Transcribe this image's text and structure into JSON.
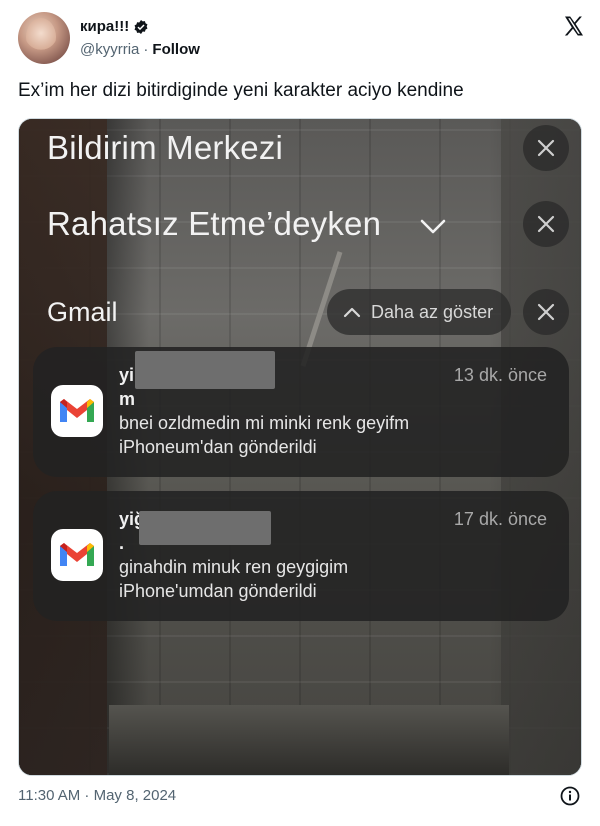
{
  "tweet": {
    "display_name": "кира!!!",
    "handle": "@kyyrria",
    "separator": "·",
    "follow_label": "Follow",
    "text": "Ex’im her dizi bitirdiginde yeni karakter aciyo kendine",
    "timestamp": "11:30 AM · May 8, 2024"
  },
  "screenshot": {
    "title": "Bildirim Merkezi",
    "dnd_label": "Rahatsız Etme’deyken",
    "app_group": "Gmail",
    "show_less_label": "Daha az göster",
    "notifications": [
      {
        "sender": "yi",
        "time": "13 dk. önce",
        "subject": "m",
        "line1": "bnei ozldmedin mi minki renk geyifm",
        "line2": "iPhoneum'dan gönderildi"
      },
      {
        "sender": "yiğ",
        "time": "17 dk. önce",
        "subject": ".",
        "line1": "ginahdin minuk ren geygigim",
        "line2": "iPhone'umdan gönderildi"
      }
    ]
  },
  "icons": {
    "verified": "verified-badge-icon",
    "platform": "x-logo-icon",
    "close": "close-icon",
    "chevron": "chevron-down-icon",
    "chevron_up": "chevron-up-icon",
    "gmail": "gmail-icon",
    "info": "info-icon"
  }
}
